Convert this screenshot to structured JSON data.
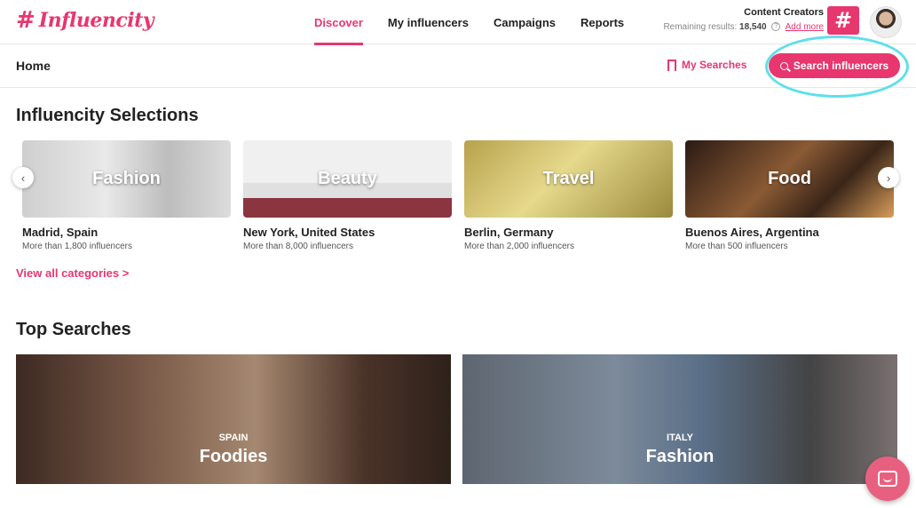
{
  "brand": {
    "mark": "#",
    "name": "Influencity",
    "accent": "#e8366f"
  },
  "nav": {
    "tabs": [
      {
        "label": "Discover",
        "active": true
      },
      {
        "label": "My influencers"
      },
      {
        "label": "Campaigns"
      },
      {
        "label": "Reports"
      }
    ]
  },
  "account": {
    "plan": "Content Creators",
    "remaining_label": "Remaining results:",
    "remaining_value": "18,540",
    "add_more": "Add more"
  },
  "subbar": {
    "breadcrumb": "Home",
    "my_searches": "My Searches",
    "search_button": "Search influencers"
  },
  "selections": {
    "title": "Influencity Selections",
    "cards": [
      {
        "category": "Fashion",
        "city": "Madrid, Spain",
        "count": "More than 1,800 influencers"
      },
      {
        "category": "Beauty",
        "city": "New York, United States",
        "count": "More than 8,000 influencers"
      },
      {
        "category": "Travel",
        "city": "Berlin, Germany",
        "count": "More than 2,000 influencers"
      },
      {
        "category": "Food",
        "city": "Buenos Aires, Argentina",
        "count": "More than 500 influencers"
      }
    ],
    "view_all": "View all categories >"
  },
  "top_searches": {
    "title": "Top Searches",
    "items": [
      {
        "country": "SPAIN",
        "theme": "Foodies"
      },
      {
        "country": "ITALY",
        "theme": "Fashion"
      }
    ]
  },
  "icons": [
    "hashtag-logo-icon",
    "info-icon",
    "bookmark-icon",
    "search-icon",
    "chevron-left-icon",
    "chevron-right-icon",
    "chat-icon"
  ]
}
